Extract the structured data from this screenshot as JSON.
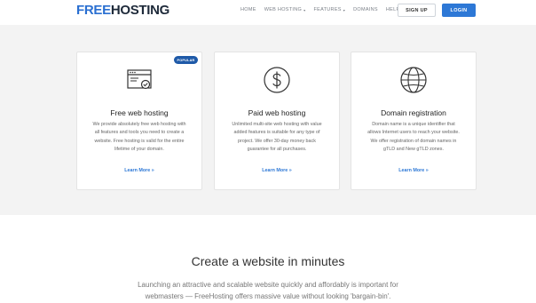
{
  "header": {
    "logo_free": "FREE",
    "logo_hosting": "HOSTING",
    "nav": [
      {
        "label": "HOME",
        "dropdown": false
      },
      {
        "label": "WEB HOSTING",
        "dropdown": true
      },
      {
        "label": "FEATURES",
        "dropdown": true
      },
      {
        "label": "DOMAINS",
        "dropdown": false
      },
      {
        "label": "HELP",
        "dropdown": true
      }
    ],
    "signup_label": "SIGN UP",
    "login_label": "LOGIN"
  },
  "cards": [
    {
      "icon": "browser-check-icon",
      "badge": "POPULAR",
      "title": "Free web hosting",
      "description": "We provide absolutely free web hosting with all features and tools you need to create a website. Free hosting is valid for the entire lifetime of your domain.",
      "link": "Learn More »"
    },
    {
      "icon": "dollar-circle-icon",
      "title": "Paid web hosting",
      "description": "Unlimited multi-site web hosting with value added features is suitable for any type of project. We offer 30-day money back guarantee for all purchases.",
      "link": "Learn More »"
    },
    {
      "icon": "globe-icon",
      "title": "Domain registration",
      "description": "Domain name is a unique identifier that allows Internet users to reach your website. We offer registration of domain names in gTLD and New gTLD zones.",
      "link": "Learn More »"
    }
  ],
  "section2": {
    "title": "Create a website in minutes",
    "text": "Launching an attractive and scalable website quickly and affordably is important for webmasters — FreeHosting offers massive value without looking 'bargain-bin'."
  },
  "colors": {
    "brand_blue": "#2a6fd1",
    "login_button": "#2d78d6",
    "badge": "#1f5aa8",
    "features_bg": "#f3f3f3"
  }
}
